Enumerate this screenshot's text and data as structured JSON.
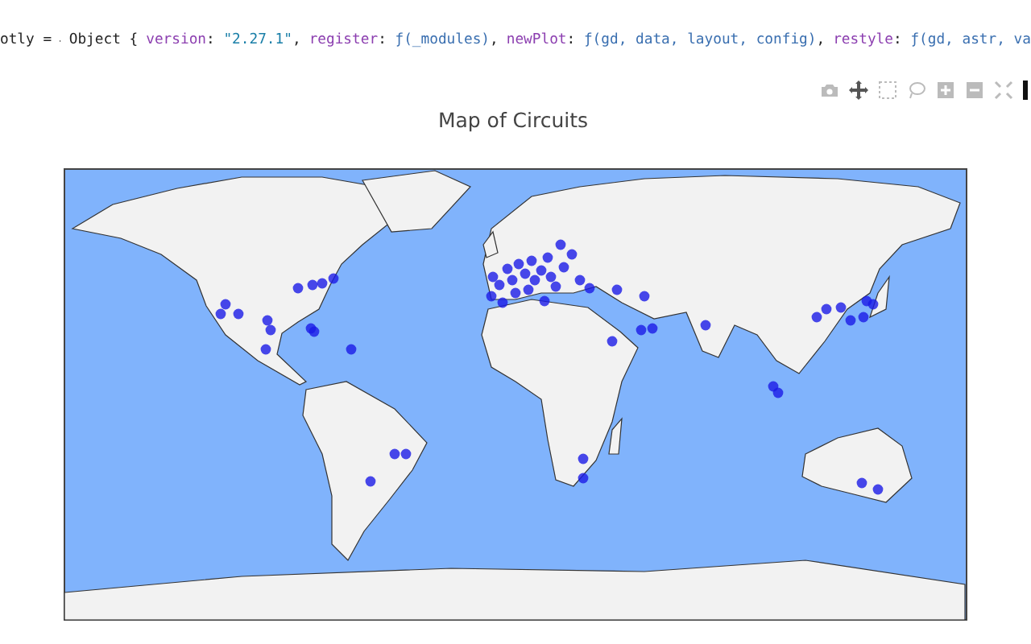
{
  "console": {
    "prefix": "otly =",
    "object_label": "Object {",
    "entries": [
      {
        "key": "version",
        "colon": ":",
        "value": "\"2.27.1\"",
        "comma": ",",
        "kind": "string"
      },
      {
        "key": "register",
        "colon": ":",
        "value": "ƒ(_modules)",
        "comma": ",",
        "kind": "function"
      },
      {
        "key": "newPlot",
        "colon": ":",
        "value": "ƒ(gd, data, layout, config)",
        "comma": ",",
        "kind": "function"
      },
      {
        "key": "restyle",
        "colon": ":",
        "value": "ƒ(gd, astr, va",
        "kind": "function"
      }
    ]
  },
  "plot": {
    "title": "Map of Circuits"
  }
}
